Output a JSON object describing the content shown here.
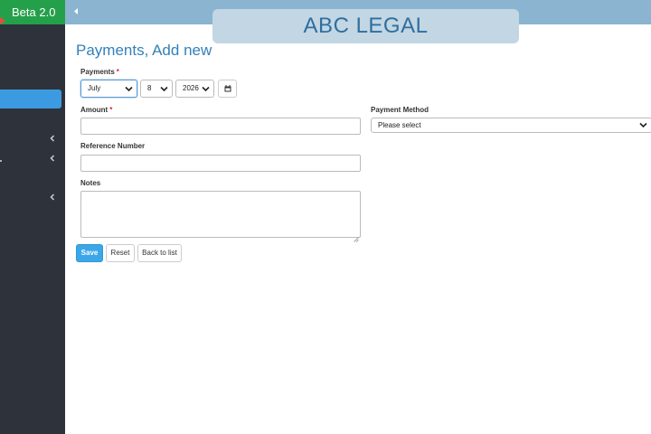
{
  "brand": {
    "label": "Beta 2.0"
  },
  "header": {
    "app_title": "ABC LEGAL"
  },
  "page": {
    "title": "Payments, Add new"
  },
  "form": {
    "payments": {
      "label": "Payments",
      "required_mark": "*",
      "month": "July",
      "day": "8",
      "year": "2026"
    },
    "amount": {
      "label": "Amount",
      "required_mark": "*",
      "value": ""
    },
    "payment_method": {
      "label": "Payment Method",
      "selected": "Please select"
    },
    "reference_number": {
      "label": "Reference Number",
      "value": ""
    },
    "notes": {
      "label": "Notes",
      "value": ""
    }
  },
  "actions": {
    "save_label": "Save",
    "reset_label": "Reset",
    "back_label": "Back to list"
  },
  "icons": {
    "collapse": "chevron-left-icon",
    "calendar": "calendar-icon",
    "dropdown": "chevron-down-icon",
    "menu_expand": "chevron-left-icon"
  },
  "colors": {
    "sidebar": "#2d323b",
    "brand": "#25a04a",
    "topbar": "#8ab4cf",
    "accent": "#3ba6e8",
    "title": "#3380b8"
  }
}
